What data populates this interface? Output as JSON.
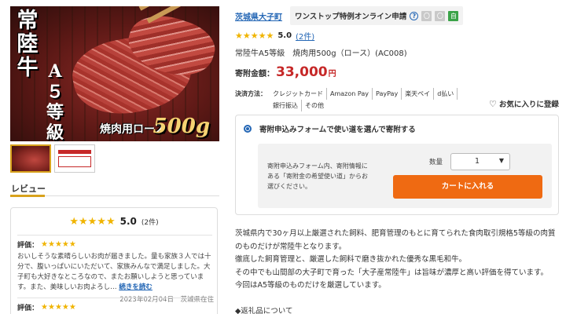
{
  "hero": {
    "vertical_title": [
      "常",
      "陸",
      "牛",
      "A",
      "５",
      "等",
      "級"
    ],
    "caption": "焼肉用ロース",
    "weight": "500g"
  },
  "reviews": {
    "tab_label": "レビュー",
    "summary_score": "5.0",
    "summary_count": "(2件)",
    "items": [
      {
        "label": "評価：",
        "body": "おいしそうな素晴らしいお肉が届きました。量も家族３人では十分で、腹いっぱいにいただいて、家族みんなで満足しました。大子町も大好きなところなので、またお願いしようと思っています。また、美味しいお肉よろし…",
        "more": "続きを読む",
        "date": "2023年02月04日",
        "location": "茨城県在住"
      },
      {
        "label": "評価："
      }
    ]
  },
  "product": {
    "town": "茨城県大子町",
    "onestop_label": "ワンストップ特例オンライン申請",
    "tags": [
      "〇",
      "〇",
      "自"
    ],
    "rating_score": "5.0",
    "rating_count": "(2件)",
    "title": "常陸牛A5等級　焼肉用500g（ロース）(AC008)",
    "price_label": "寄附金額：",
    "price_value": "33,000",
    "price_unit": "円",
    "payment_label": "決済方法：",
    "payment_methods": [
      "クレジットカード",
      "Amazon Pay",
      "PayPay",
      "楽天ペイ",
      "d払い",
      "銀行振込",
      "その他"
    ],
    "favorite_label": "お気に入りに登録"
  },
  "purchase": {
    "option_label": "寄附申込みフォームで使い道を選んで寄附する",
    "description": "寄附申込みフォーム内、寄附情報にある「寄附金の希望使い道」からお選びください。",
    "qty_label": "数量",
    "qty_value": "1",
    "cart_button": "カートに入れる"
  },
  "description": {
    "lines": [
      "茨城県内で30ヶ月以上厳選された飼料、肥育管理のもとに育てられた食肉取引規格5等級の肉質のものだけが常陸牛となります。",
      "徹底した飼育管理と、厳選した飼料で磨き抜かれた優秀な黒毛和牛。",
      "その中でも山間部の大子町で育った「大子産常陸牛」は旨味が濃厚と高い評価を得ています。",
      "今回はA5等級のものだけを厳選しています。"
    ],
    "return_note": "◆返礼品について"
  }
}
